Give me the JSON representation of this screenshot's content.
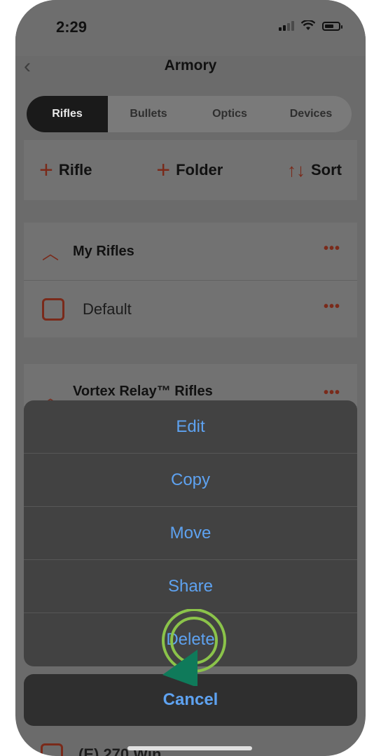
{
  "status": {
    "time": "2:29"
  },
  "nav": {
    "back_icon": "chevron-left-icon",
    "title": "Armory"
  },
  "tabs": [
    {
      "label": "Rifles",
      "active": true
    },
    {
      "label": "Bullets",
      "active": false
    },
    {
      "label": "Optics",
      "active": false
    },
    {
      "label": "Devices",
      "active": false
    }
  ],
  "toolbar": {
    "add_rifle": "Rifle",
    "add_folder": "Folder",
    "sort": "Sort"
  },
  "groups": {
    "my_rifles": {
      "title": "My Rifles",
      "items": [
        {
          "label": "Default"
        }
      ]
    },
    "vortex": {
      "title": "Vortex Relay™ Rifles"
    }
  },
  "action_sheet": {
    "items": [
      "Edit",
      "Copy",
      "Move",
      "Share",
      "Delete"
    ],
    "cancel": "Cancel"
  },
  "peek_row": {
    "label": "(E) 270 Win"
  },
  "colors": {
    "accent": "#c0452a",
    "action_blue": "#5ea2f0",
    "tap_indicator": "#8bc34a",
    "cursor": "#0f7a5a"
  }
}
